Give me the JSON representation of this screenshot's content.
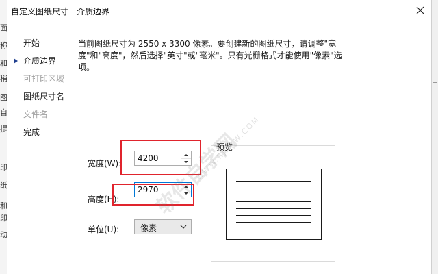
{
  "background": {
    "left_fragments": [
      "面",
      "称",
      "和",
      "稍",
      "图",
      "自",
      "提",
      "印",
      "纸",
      "和",
      "印",
      "动"
    ]
  },
  "dialog": {
    "title": "自定义图纸尺寸 - 介质边界",
    "description": "当前图纸尺寸为 2550 x 3300 像素。要创建新的图纸尺寸，请调整\"宽度\"和\"高度\"，然后选择\"英寸\"或\"毫米\"。只有光栅格式才能使用\"像素\"选项。"
  },
  "nav": {
    "items": [
      {
        "label": "开始",
        "enabled": true,
        "current": false
      },
      {
        "label": "介质边界",
        "enabled": true,
        "current": true
      },
      {
        "label": "可打印区域",
        "enabled": false,
        "current": false
      },
      {
        "label": "图纸尺寸名",
        "enabled": true,
        "current": false
      },
      {
        "label": "文件名",
        "enabled": false,
        "current": false
      },
      {
        "label": "完成",
        "enabled": true,
        "current": false
      }
    ]
  },
  "fields": {
    "width_label": "宽度(W):",
    "width_value": "4200",
    "height_label": "高度(H):",
    "height_value": "2970",
    "unit_label": "单位(U):",
    "unit_value": "像素"
  },
  "preview": {
    "label": "预览"
  },
  "watermark": {
    "text": "软件自学网",
    "sub": "WWW.RJZXW.COM"
  },
  "colors": {
    "highlight": "#e0242d",
    "focus_border": "#0078d7",
    "nav_arrow": "#1f3f8f"
  }
}
